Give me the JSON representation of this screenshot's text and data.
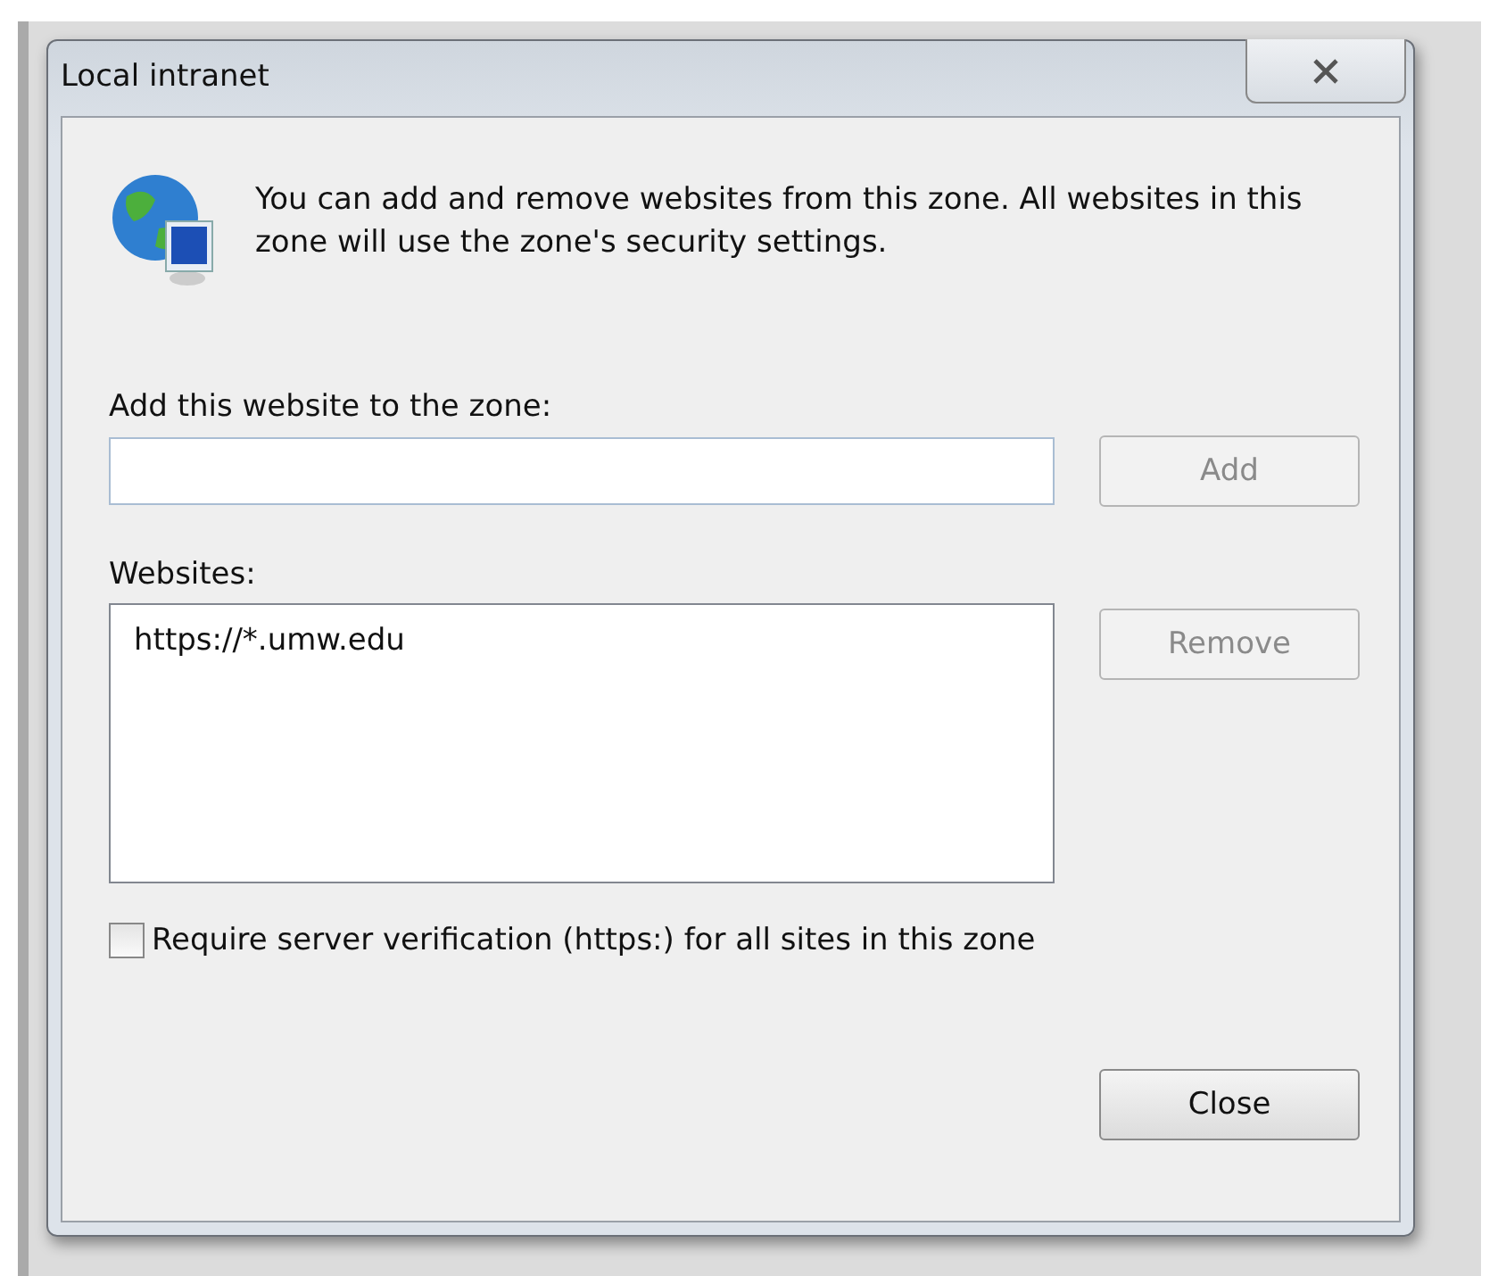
{
  "window": {
    "title": "Local intranet"
  },
  "description": "You can add and remove websites from this zone. All websites in this zone will use the zone's security settings.",
  "add_field": {
    "label": "Add this website to the zone:"
  },
  "add_button": {
    "label": "Add",
    "disabled": true
  },
  "websites": {
    "label": "Websites:",
    "items": [
      {
        "text": "https://*.umw.edu",
        "selected": false
      }
    ]
  },
  "remove_button": {
    "label": "Remove",
    "disabled": true
  },
  "require_verification": {
    "label": "Require server verification (https:) for all sites in this zone",
    "checked": false
  },
  "close_button": {
    "label": "Close",
    "disabled": false
  }
}
